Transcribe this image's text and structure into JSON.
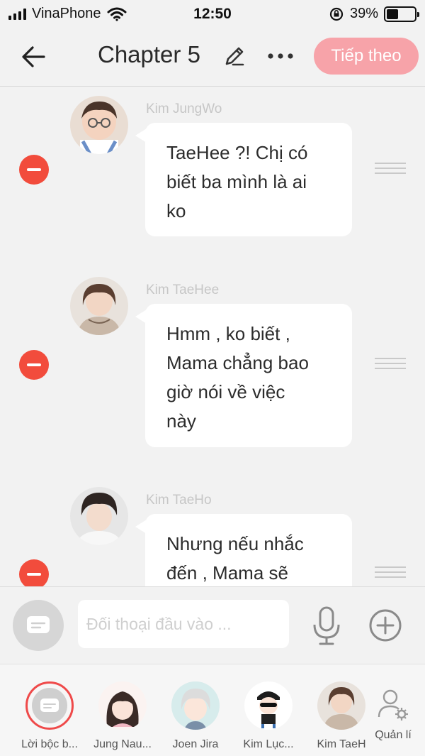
{
  "status_bar": {
    "carrier": "VinaPhone",
    "time": "12:50",
    "battery": "39%",
    "battery_level": 0.39
  },
  "nav": {
    "title": "Chapter 5",
    "next_label": "Tiếp theo"
  },
  "messages": [
    {
      "speaker": "Kim JungWo",
      "lines": [
        "TaeHee ?! Chị có",
        "biết ba mình là ai",
        "ko"
      ]
    },
    {
      "speaker": "Kim TaeHee",
      "lines": [
        "Hmm , ko biết ,",
        "Mama chẳng bao",
        "giờ nói về việc",
        "này"
      ]
    },
    {
      "speaker": "Kim TaeHo",
      "lines": [
        "Nhưng nếu nhắc",
        "đến , Mama sẽ"
      ]
    }
  ],
  "input": {
    "placeholder": "Đối thoại đầu vào ..."
  },
  "characters": [
    {
      "label": "Lời bộc b..."
    },
    {
      "label": "Jung Nau..."
    },
    {
      "label": "Joen Jira"
    },
    {
      "label": "Kim Lục..."
    },
    {
      "label": "Kim TaeH"
    }
  ],
  "manage_label": "Quản lí",
  "colors": {
    "accent_pink": "#f7a3a9",
    "delete_red": "#f24c3c",
    "background": "#f2f2f2"
  },
  "icons": {
    "back": "arrow-left-icon",
    "edit": "pencil-icon",
    "more": "ellipsis-icon",
    "mic": "microphone-icon",
    "add": "plus-circle-icon",
    "manage": "user-gear-icon"
  }
}
